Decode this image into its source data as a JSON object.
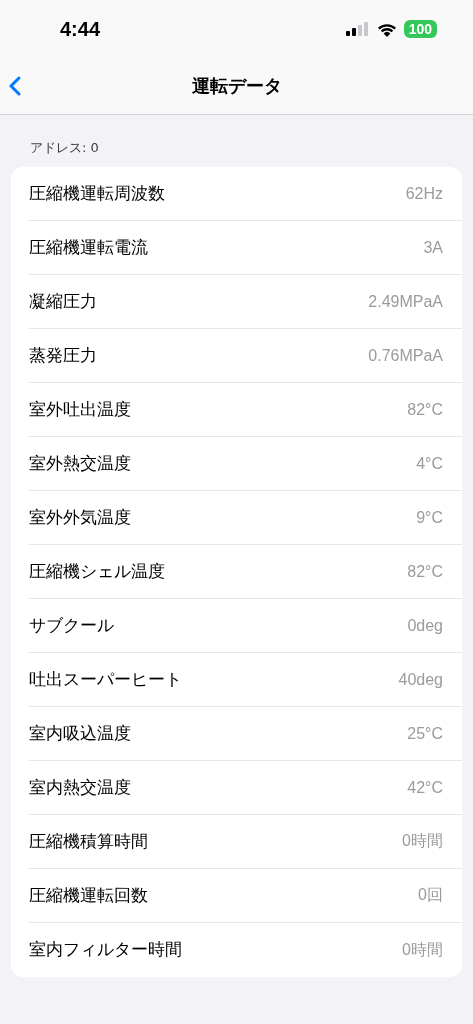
{
  "status_bar": {
    "time": "4:44",
    "battery": "100"
  },
  "nav_bar": {
    "title": "運転データ"
  },
  "section": {
    "header": "アドレス: 0"
  },
  "rows": [
    {
      "label": "圧縮機運転周波数",
      "value": "62Hz"
    },
    {
      "label": "圧縮機運転電流",
      "value": "3A"
    },
    {
      "label": "凝縮圧力",
      "value": "2.49MPaA"
    },
    {
      "label": "蒸発圧力",
      "value": "0.76MPaA"
    },
    {
      "label": "室外吐出温度",
      "value": "82°C"
    },
    {
      "label": "室外熱交温度",
      "value": "4°C"
    },
    {
      "label": "室外外気温度",
      "value": "9°C"
    },
    {
      "label": "圧縮機シェル温度",
      "value": "82°C"
    },
    {
      "label": "サブクール",
      "value": "0deg"
    },
    {
      "label": "吐出スーパーヒート",
      "value": "40deg"
    },
    {
      "label": "室内吸込温度",
      "value": "25°C"
    },
    {
      "label": "室内熱交温度",
      "value": "42°C"
    },
    {
      "label": "圧縮機積算時間",
      "value": "0時間"
    },
    {
      "label": "圧縮機運転回数",
      "value": "0回"
    },
    {
      "label": "室内フィルター時間",
      "value": "0時間"
    }
  ]
}
